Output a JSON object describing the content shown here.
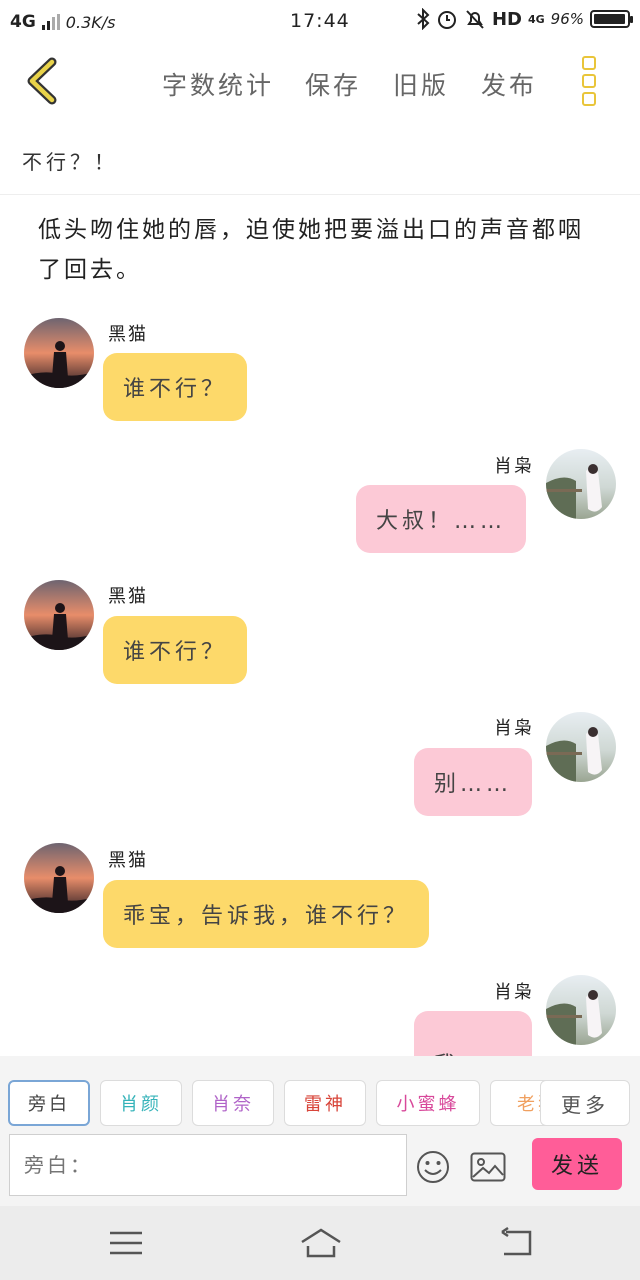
{
  "status_bar": {
    "network": "4G",
    "speed": "0.3K/s",
    "time": "17:44",
    "hd": "HD",
    "network_right": "4G",
    "battery": "96%",
    "battery_level": 0.96
  },
  "toolbar": {
    "word_count": "字数统计",
    "save": "保存",
    "old_version": "旧版",
    "publish": "发布"
  },
  "document": {
    "title": "不行？！",
    "narration": "低头吻住她的唇，迫使她把要溢出口的声音都咽了回去。"
  },
  "messages": [
    {
      "sender": "黑猫",
      "text": "谁不行？",
      "side": "left"
    },
    {
      "sender": "肖枭",
      "text": "大叔！……",
      "side": "right"
    },
    {
      "sender": "黑猫",
      "text": "谁不行？",
      "side": "left"
    },
    {
      "sender": "肖枭",
      "text": "别……",
      "side": "right"
    },
    {
      "sender": "黑猫",
      "text": "乖宝，告诉我，谁不行？",
      "side": "left"
    },
    {
      "sender": "肖枭",
      "text": "我……",
      "side": "right"
    }
  ],
  "characters": [
    {
      "name": "旁白",
      "color": "#555555"
    },
    {
      "name": "肖颜",
      "color": "#35b3b9"
    },
    {
      "name": "肖奈",
      "color": "#b064c8"
    },
    {
      "name": "雷神",
      "color": "#d8453a"
    },
    {
      "name": "小蜜蜂",
      "color": "#d8489a"
    },
    {
      "name": "老狐",
      "color": "#f0a060"
    }
  ],
  "more_label": "更多",
  "input": {
    "placeholder": "旁白："
  },
  "send_label": "发送",
  "colors": {
    "accent_yellow": "#fdd96a",
    "bubble_pink": "#fcc9d6",
    "send_button": "#ff5d98",
    "icon_yellow": "#e9c53a"
  }
}
